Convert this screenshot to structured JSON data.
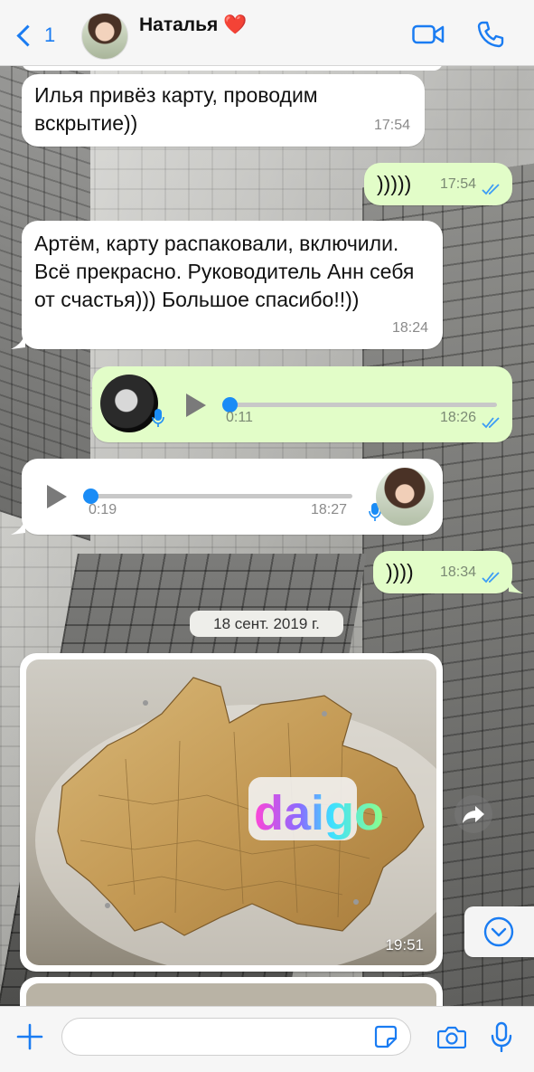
{
  "header": {
    "back_count": "1",
    "contact_name": "Наталья",
    "emoji": "❤️"
  },
  "messages": [
    {
      "id": "m1",
      "direction": "incoming",
      "text": "Илья привёз карту, проводим вскрытие))",
      "time": "17:54"
    },
    {
      "id": "m2",
      "direction": "outgoing",
      "text": "))))) ",
      "time": "17:54",
      "status": "read"
    },
    {
      "id": "m3",
      "direction": "incoming",
      "text": "Артём, карту распаковали, включили. Всё прекрасно. Руководитель Анн себя от счастья))) Большое спасибо!!))",
      "time": "18:24"
    },
    {
      "id": "m4",
      "direction": "outgoing",
      "type": "voice",
      "duration": "0:11",
      "progress": 0,
      "time": "18:26",
      "status": "read"
    },
    {
      "id": "m5",
      "direction": "incoming",
      "type": "voice",
      "duration": "0:19",
      "progress": 0,
      "time": "18:27"
    },
    {
      "id": "m6",
      "direction": "outgoing",
      "text": "))))",
      "time": "18:34",
      "status": "read"
    },
    {
      "id": "m7",
      "direction": "incoming",
      "type": "photo",
      "time": "19:51",
      "photo_text": "daigo"
    }
  ],
  "date_separator": "18 сент. 2019 г.",
  "input": {
    "placeholder": "",
    "value": ""
  },
  "colors": {
    "accent": "#1a7cf2",
    "incoming_bubble": "#ffffff",
    "outgoing_bubble": "#e2fdc8",
    "read_ticks": "#3c9cf5",
    "heart": "#e0151c"
  },
  "icons": [
    "chevron-left-icon",
    "video-icon",
    "phone-icon",
    "mic-icon",
    "play-icon",
    "forward-icon",
    "chevron-down-icon",
    "plus-icon",
    "sticker-icon",
    "camera-icon"
  ]
}
